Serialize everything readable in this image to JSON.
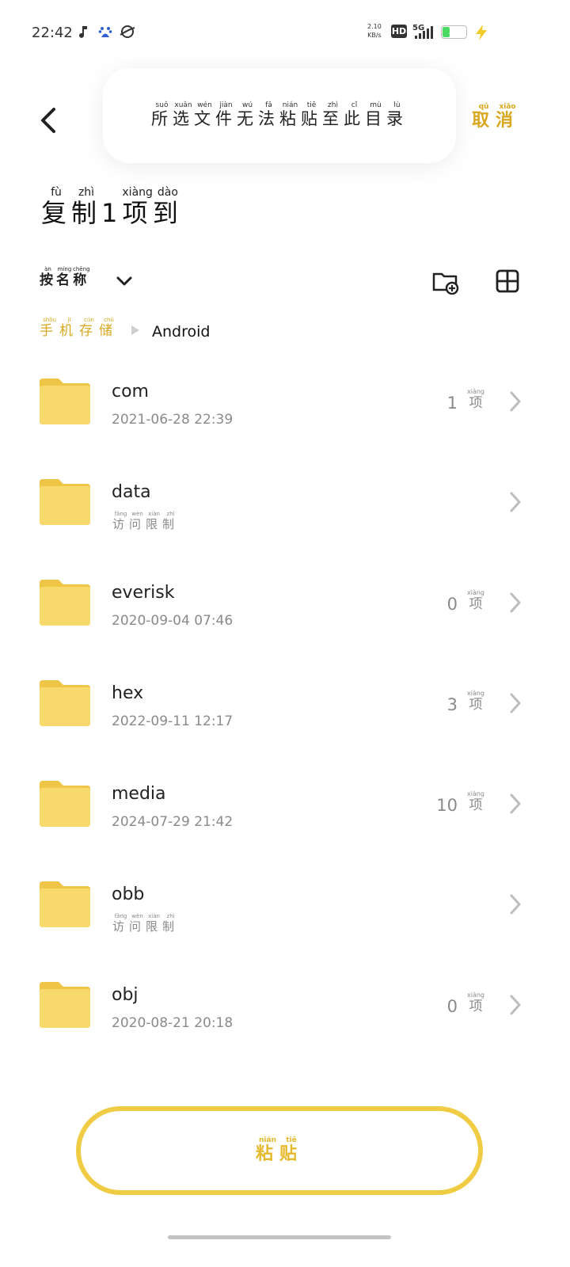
{
  "status_bar": {
    "time": "22:42",
    "speed_value": "2.10",
    "speed_unit": "KB/s",
    "hd": "HD",
    "network": "5G",
    "battery": "30"
  },
  "header": {
    "toast": [
      {
        "c": "所",
        "p": "suǒ"
      },
      {
        "c": "选",
        "p": "xuǎn"
      },
      {
        "c": "文",
        "p": "wén"
      },
      {
        "c": "件",
        "p": "jiàn"
      },
      {
        "c": "无",
        "p": "wú"
      },
      {
        "c": "法",
        "p": "fǎ"
      },
      {
        "c": "粘",
        "p": "nián"
      },
      {
        "c": "贴",
        "p": "tiē"
      },
      {
        "c": "至",
        "p": "zhì"
      },
      {
        "c": "此",
        "p": "cǐ"
      },
      {
        "c": "目",
        "p": "mù"
      },
      {
        "c": "录",
        "p": "lù"
      }
    ],
    "cancel": [
      {
        "c": "取",
        "p": "qǔ"
      },
      {
        "c": "消",
        "p": "xiāo"
      }
    ],
    "title": [
      {
        "c": "复",
        "p": "fù"
      },
      {
        "c": "制",
        "p": "zhì"
      },
      {
        "c": "1",
        "p": ""
      },
      {
        "c": "项",
        "p": "xiàng"
      },
      {
        "c": "到",
        "p": "dào"
      }
    ]
  },
  "toolbar": {
    "sort": [
      {
        "c": "按",
        "p": "àn"
      },
      {
        "c": "名",
        "p": "míng"
      },
      {
        "c": "称",
        "p": "chēng"
      }
    ]
  },
  "breadcrumb": {
    "root": [
      {
        "c": "手",
        "p": "shǒu"
      },
      {
        "c": "机",
        "p": "jī"
      },
      {
        "c": "存",
        "p": "cún"
      },
      {
        "c": "储",
        "p": "chǔ"
      }
    ],
    "current": "Android"
  },
  "restricted_label": [
    {
      "c": "访",
      "p": "fǎng"
    },
    {
      "c": "问",
      "p": "wèn"
    },
    {
      "c": "限",
      "p": "xiàn"
    },
    {
      "c": "制",
      "p": "zhì"
    }
  ],
  "item_unit": {
    "c": "项",
    "p": "xiàng"
  },
  "folders": [
    {
      "name": "com",
      "date": "2021-06-28 22:39",
      "count": "1",
      "restricted": false
    },
    {
      "name": "data",
      "date": "",
      "count": "",
      "restricted": true
    },
    {
      "name": "everisk",
      "date": "2020-09-04 07:46",
      "count": "0",
      "restricted": false
    },
    {
      "name": "hex",
      "date": "2022-09-11 12:17",
      "count": "3",
      "restricted": false
    },
    {
      "name": "media",
      "date": "2024-07-29 21:42",
      "count": "10",
      "restricted": false
    },
    {
      "name": "obb",
      "date": "",
      "count": "",
      "restricted": true
    },
    {
      "name": "obj",
      "date": "2020-08-21 20:18",
      "count": "0",
      "restricted": false
    }
  ],
  "paste_button": [
    {
      "c": "粘",
      "p": "nián"
    },
    {
      "c": "贴",
      "p": "tiē"
    }
  ],
  "colors": {
    "accent": "#d9a81f",
    "folder": "#f7d96c",
    "folder_tab": "#efc548",
    "button_border": "#f0cc45"
  }
}
